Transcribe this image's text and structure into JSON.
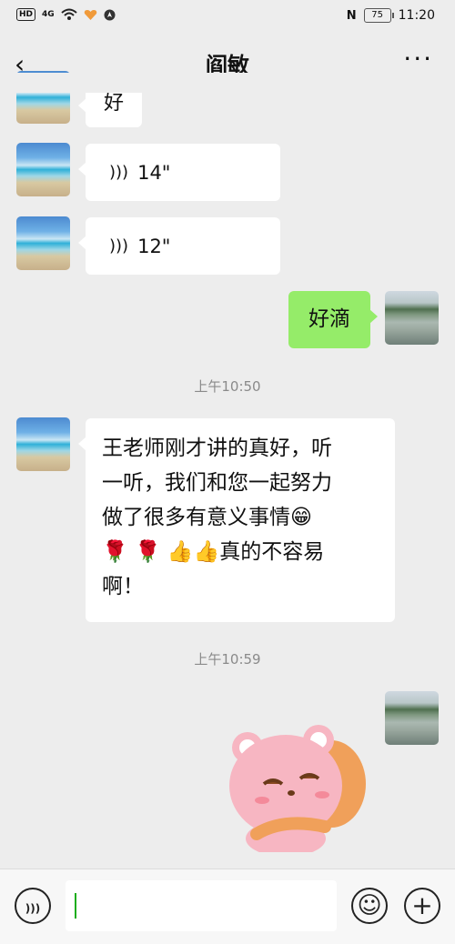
{
  "status_bar": {
    "hd": "HD",
    "network": "4G",
    "battery": "75",
    "time": "11:20"
  },
  "header": {
    "title": "阎敏",
    "back": "‹",
    "more": "···"
  },
  "messages": {
    "partial_text": "好",
    "voice1_duration": "14\"",
    "voice2_duration": "12\"",
    "reply1": "好滴",
    "time1": "上午10:50",
    "long_text_line1": "王老师刚才讲的真好，听",
    "long_text_line2": "一听，我们和您一起努力",
    "long_text_line3": "做了很多有意义事情",
    "long_text_line4_tail": "真的不容易",
    "long_text_line5": "啊！",
    "time2": "上午10:59"
  },
  "icons": {
    "voice_wave": ")))",
    "grin": "😁",
    "flower": "🌹",
    "thumb": "👍",
    "voice_input": ")))",
    "emoji": "☺",
    "plus": "+"
  },
  "colors": {
    "background": "#ededed",
    "sent_bubble": "#95ec69",
    "received_bubble": "#ffffff",
    "cursor": "#1aad19"
  }
}
